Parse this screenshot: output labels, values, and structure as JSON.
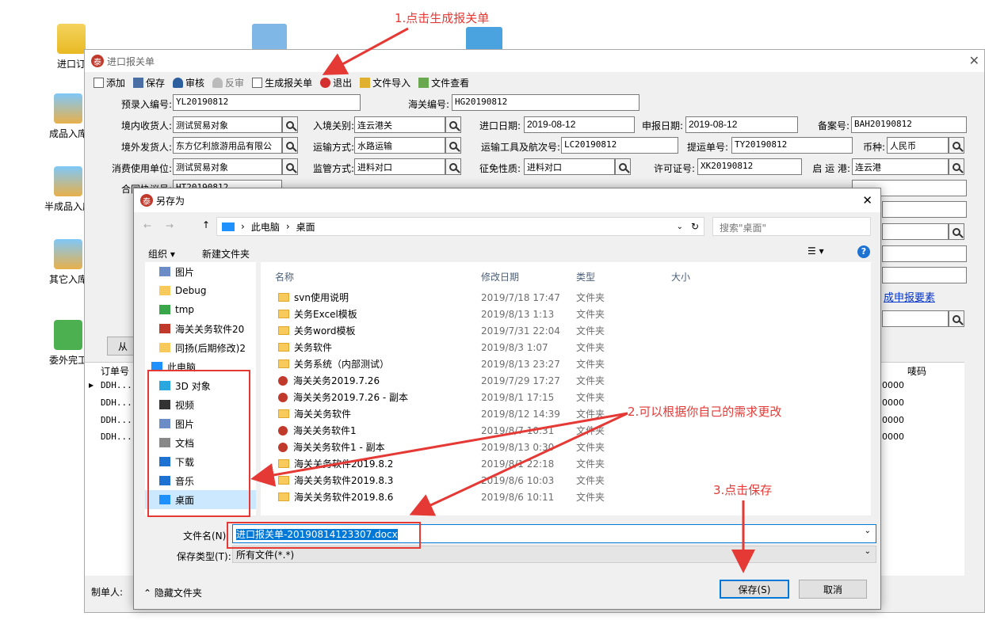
{
  "desktop": {
    "icons": [
      "进口订",
      "成品入库",
      "半成品入库",
      "其它入库",
      "委外完工"
    ]
  },
  "main_window": {
    "title": "进口报关单",
    "toolbar": [
      "添加",
      "保存",
      "审核",
      "反审",
      "生成报关单",
      "退出",
      "文件导入",
      "文件查看"
    ],
    "fields": {
      "pre_no_label": "预录入编号:",
      "pre_no": "YL20190812",
      "customs_no_label": "海关编号:",
      "customs_no": "HG20190812",
      "consignee_label": "境内收货人:",
      "consignee": "测试贸易对象",
      "entry_port_label": "入境关别:",
      "entry_port": "连云港关",
      "import_date_label": "进口日期:",
      "import_date": "2019-08-12",
      "declare_date_label": "申报日期:",
      "declare_date": "2019-08-12",
      "record_no_label": "备案号:",
      "record_no": "BAH20190812",
      "shipper_label": "境外发货人:",
      "shipper": "东方亿利旅游用品有限公",
      "transport_label": "运输方式:",
      "transport": "水路运输",
      "voyage_label": "运输工具及航次号:",
      "voyage": "LC20190812",
      "bill_label": "提运单号:",
      "bill": "TY20190812",
      "currency_label": "币种:",
      "currency": "人民币",
      "consumer_label": "消费使用单位:",
      "consumer": "测试贸易对象",
      "supervision_label": "监管方式:",
      "supervision": "进料对口",
      "tax_label": "征免性质:",
      "tax": "进料对口",
      "license_label": "许可证号:",
      "license": "XK20190812",
      "depart_port_label": "启 运 港:",
      "depart_port": "连云港",
      "contract_label": "合同协议号:",
      "contract": "HT20190812"
    },
    "grid": {
      "col1": "订单号",
      "col_last": "唛码",
      "rows": [
        "DDH...",
        "DDH...",
        "DDH...",
        "DDH..."
      ],
      "right_vals": [
        "0000",
        "0000",
        "0000",
        "0000"
      ]
    },
    "link": "成申报要素",
    "maker_label": "制单人:",
    "from_btn": "从"
  },
  "dialog": {
    "title": "另存为",
    "breadcrumb": [
      "此电脑",
      "桌面"
    ],
    "search_placeholder": "搜索\"桌面\"",
    "organize": "组织 ▾",
    "new_folder": "新建文件夹",
    "columns": [
      "名称",
      "修改日期",
      "类型",
      "大小"
    ],
    "nav": [
      "图片",
      "Debug",
      "tmp",
      "海关关务软件20",
      "同扬(后期修改)2",
      "此电脑",
      "3D 对象",
      "视频",
      "图片",
      "文档",
      "下载",
      "音乐",
      "桌面"
    ],
    "files": [
      {
        "name": "svn使用说明",
        "date": "2019/7/18 17:47",
        "type": "文件夹",
        "err": false
      },
      {
        "name": "关务Excel模板",
        "date": "2019/8/13 1:13",
        "type": "文件夹",
        "err": false
      },
      {
        "name": "关务word模板",
        "date": "2019/7/31 22:04",
        "type": "文件夹",
        "err": false
      },
      {
        "name": "关务软件",
        "date": "2019/8/3 1:07",
        "type": "文件夹",
        "err": false
      },
      {
        "name": "关务系统（内部测试）",
        "date": "2019/8/13 23:27",
        "type": "文件夹",
        "err": false
      },
      {
        "name": "海关关务2019.7.26",
        "date": "2019/7/29 17:27",
        "type": "文件夹",
        "err": true
      },
      {
        "name": "海关关务2019.7.26 - 副本",
        "date": "2019/8/1 17:15",
        "type": "文件夹",
        "err": true
      },
      {
        "name": "海关关务软件",
        "date": "2019/8/12 14:39",
        "type": "文件夹",
        "err": false
      },
      {
        "name": "海关关务软件1",
        "date": "2019/8/7 10:31",
        "type": "文件夹",
        "err": true
      },
      {
        "name": "海关关务软件1 - 副本",
        "date": "2019/8/13 0:30",
        "type": "文件夹",
        "err": true
      },
      {
        "name": "海关关务软件2019.8.2",
        "date": "2019/8/1 22:18",
        "type": "文件夹",
        "err": false
      },
      {
        "name": "海关关务软件2019.8.3",
        "date": "2019/8/6 10:03",
        "type": "文件夹",
        "err": false
      },
      {
        "name": "海关关务软件2019.8.6",
        "date": "2019/8/6 10:11",
        "type": "文件夹",
        "err": false
      }
    ],
    "filename_label": "文件名(N):",
    "filename": "进口报关单-20190814123307.docx",
    "filetype_label": "保存类型(T):",
    "filetype": "所有文件(*.*)",
    "hide_folders": "隐藏文件夹",
    "save": "保存(S)",
    "cancel": "取消"
  },
  "annotations": {
    "a1": "1.点击生成报关单",
    "a2": "2.可以根据你自己的需求更改",
    "a3": "3.点击保存"
  },
  "colors": {
    "accent": "#0078d7",
    "annotation": "#e53935"
  }
}
